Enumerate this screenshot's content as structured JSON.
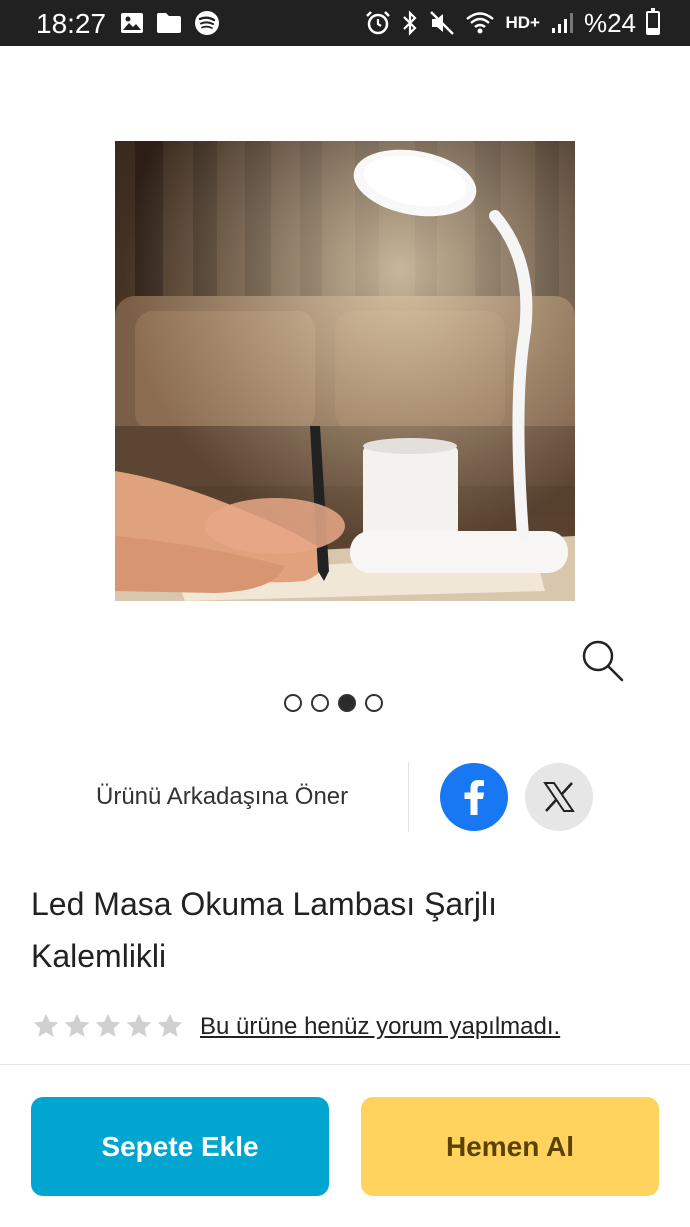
{
  "status_bar": {
    "time": "18:27",
    "network_label": "HD+",
    "battery_text": "%24",
    "battery_level": 0.24,
    "icons": [
      "image-icon",
      "folder-icon",
      "spotify-icon",
      "alarm-icon",
      "bluetooth-icon",
      "mute-icon",
      "wifi-icon",
      "signal-icon",
      "battery-icon"
    ]
  },
  "gallery": {
    "image_count": 4,
    "active_index": 2,
    "zoom_icon": "search-icon"
  },
  "share": {
    "label": "Ürünü Arkadaşına Öner",
    "networks": [
      "facebook",
      "x"
    ]
  },
  "product": {
    "title_line1": "Led Masa Okuma Lambası Şarjlı",
    "title_line2": "Kalemlikli"
  },
  "rating": {
    "stars": 0,
    "max_stars": 5,
    "review_text": "Bu ürüne henüz yorum yapılmadı."
  },
  "actions": {
    "add_to_cart": "Sepete Ekle",
    "buy_now": "Hemen Al"
  },
  "colors": {
    "status_bar": "#212121",
    "add_to_cart": "#00a5d0",
    "buy_now": "#ffd35e",
    "buy_now_text": "#5a4200",
    "facebook": "#1877f2",
    "x_button": "#e6e6e6",
    "star_empty": "#d0d0d0"
  }
}
